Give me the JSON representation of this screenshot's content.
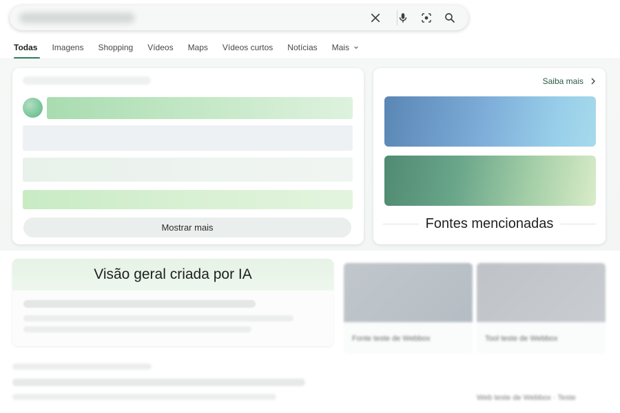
{
  "search": {
    "icons": [
      "close-icon",
      "mic-icon",
      "lens-icon",
      "search-icon"
    ]
  },
  "tabs": [
    {
      "label": "Todas",
      "active": true
    },
    {
      "label": "Imagens",
      "active": false
    },
    {
      "label": "Shopping",
      "active": false
    },
    {
      "label": "Vídeos",
      "active": false
    },
    {
      "label": "Maps",
      "active": false
    },
    {
      "label": "Vídeos curtos",
      "active": false
    },
    {
      "label": "Notícias",
      "active": false
    },
    {
      "label": "Mais",
      "active": false
    }
  ],
  "overview_card": {
    "show_more_label": "Mostrar mais"
  },
  "sources_card": {
    "learn_more_label": "Saiba mais",
    "title": "Fontes mencionadas"
  },
  "ai_overview": {
    "title": "Visão geral criada por IA"
  },
  "source_cards": [
    {
      "caption": "Fonte teste de Webbox"
    },
    {
      "caption": "Tool teste de Webbox"
    }
  ],
  "footer": {
    "right_text": "Web teste de Webbox · Teste"
  },
  "colors": {
    "accent": "#2e7d5b",
    "link": "#2a5a42"
  }
}
